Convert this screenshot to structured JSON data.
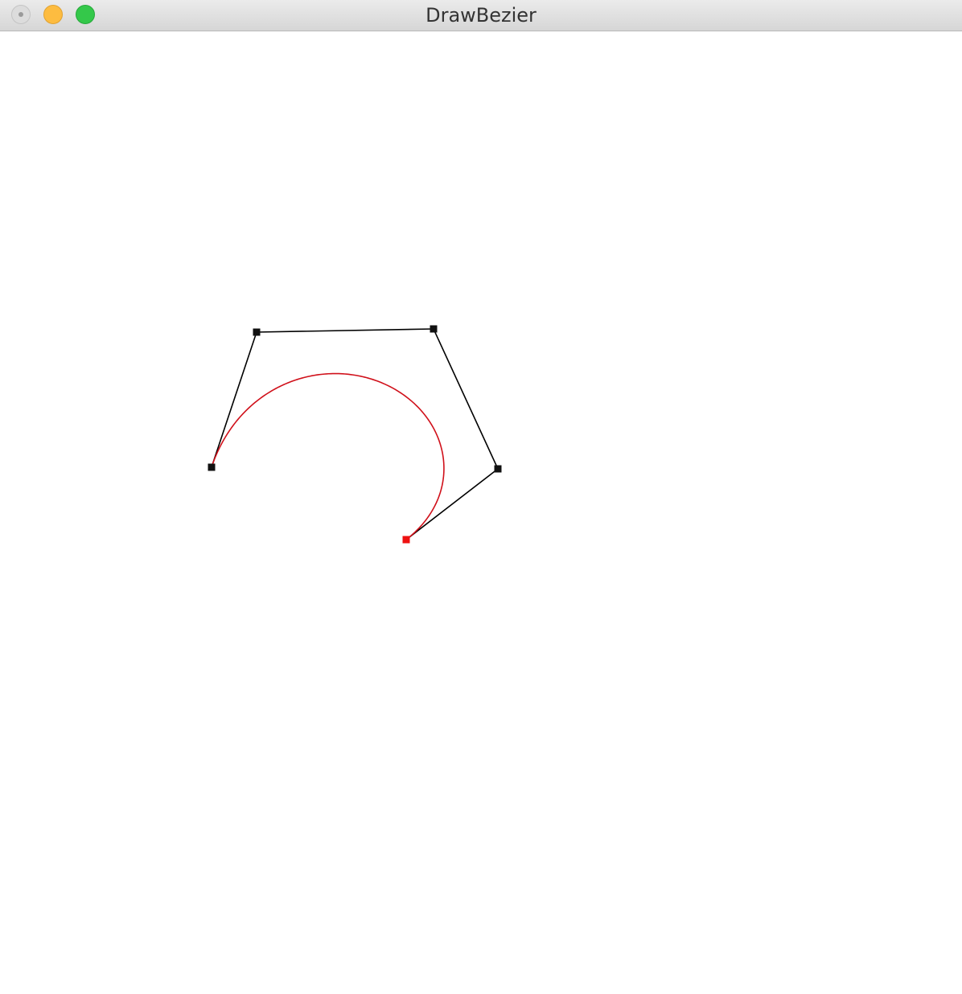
{
  "window": {
    "title": "DrawBezier"
  },
  "buttons": {
    "close": "close-icon",
    "minimize": "minimize-icon",
    "zoom": "zoom-icon"
  },
  "colors": {
    "curve": "#d0101a",
    "control_polygon": "#000000",
    "control_point": "#111111",
    "selected_point": "#ee1111",
    "background": "#ffffff"
  },
  "bezier": {
    "degree": 4,
    "control_point_count": 5,
    "selected_point_index": 4
  }
}
